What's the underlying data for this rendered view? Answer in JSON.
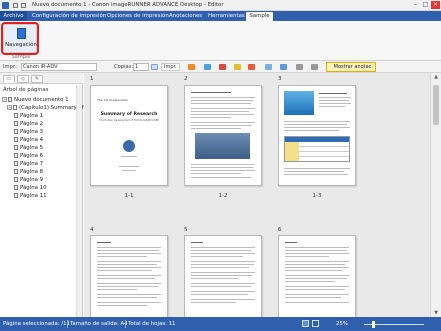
{
  "window": {
    "title": "Nuevo documento 1 - Canon imageRUNNER ADVANCE Desktop - Editor",
    "controls": {
      "minimize": "–",
      "maximize": "□",
      "close": "×"
    }
  },
  "ribbon": {
    "tabs": [
      "Archivo",
      "Configuración de impresión",
      "Opciones de impresión",
      "Anotaciones",
      "Herramientas",
      "Sample"
    ],
    "active_tab": "Sample",
    "nav_button": "Navegación",
    "group_label": "Sample"
  },
  "toolbar": {
    "printer_label": "Impr.:",
    "printer_value": "Canon iR-ADV",
    "copies_label": "Copias:",
    "copies_value": "1",
    "print_button": "Impr.",
    "annotations_button": "Mostrar anotac."
  },
  "left_pane": {
    "tab_icons": [
      "pages-tab-icon",
      "bookmarks-tab-icon",
      "annotations-tab-icon"
    ],
    "tree_header": "Árbol de páginas",
    "root": "Nuevo documento 1",
    "chapter": "(Capítulo1) Summary of R",
    "pages": [
      "Página 1",
      "Página 2",
      "Página 3",
      "Página 4",
      "Página 5",
      "Página 6",
      "Página 7",
      "Página 8",
      "Página 9",
      "Página 10",
      "Página 11"
    ]
  },
  "main": {
    "chapter_numbers": [
      "1",
      "2",
      "3",
      "4",
      "5",
      "6"
    ],
    "page_labels": [
      "1-1",
      "1-2",
      "1-3"
    ],
    "page1_small": "The 1st Organization",
    "page1_title": "Summary of Research",
    "page1_subtitle": "The Human Development of TOKYO-CANON CORP"
  },
  "status": {
    "selected": "Página seleccionada: /11",
    "output_size": "Tamaño de salida: A4",
    "total_sheets": "Total de hojas: 11",
    "zoom": "25%"
  },
  "colors": {
    "ribbon_blue": "#2f5fad",
    "highlight_red": "#e02020",
    "annot_yellow": "#fff3c2"
  }
}
